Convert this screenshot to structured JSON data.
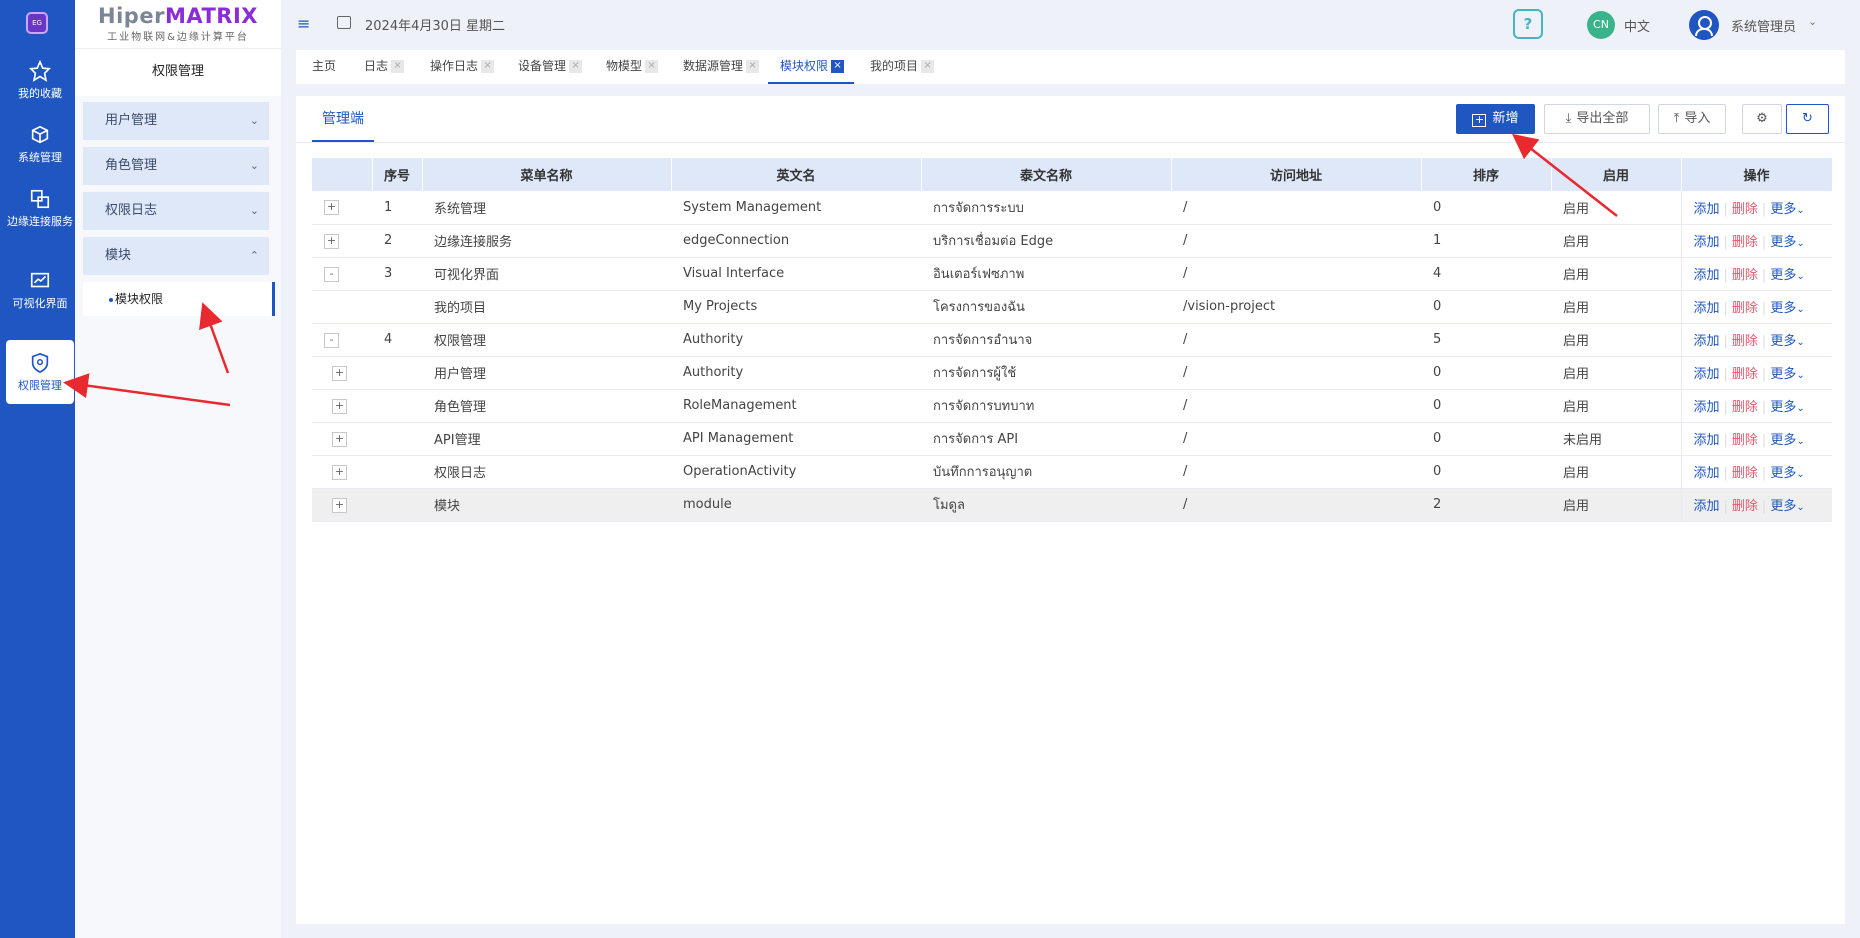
{
  "rail": {
    "logo": "EG",
    "items": [
      {
        "label": "我的收藏",
        "icon": "star-icon"
      },
      {
        "label": "系统管理",
        "icon": "cube-icon"
      },
      {
        "label": "边缘连接服务",
        "icon": "connect-icon"
      },
      {
        "label": "可视化界面",
        "icon": "chart-icon"
      },
      {
        "label": "权限管理",
        "icon": "shield-icon"
      }
    ]
  },
  "brand": {
    "name_a": "Hiper",
    "name_b": "MATRIX",
    "tagline": "工业物联网&边缘计算平台"
  },
  "sidebar": {
    "title": "权限管理",
    "menus": [
      "用户管理",
      "角色管理",
      "权限日志",
      "模块"
    ],
    "submenu": "模块权限"
  },
  "header": {
    "date": "2024年4月30日 星期二",
    "lang_badge": "CN",
    "lang": "中文",
    "user": "系统管理员",
    "help": "?"
  },
  "tabs": [
    {
      "label": "主页"
    },
    {
      "label": "日志"
    },
    {
      "label": "操作日志"
    },
    {
      "label": "设备管理"
    },
    {
      "label": "物模型"
    },
    {
      "label": "数据源管理"
    },
    {
      "label": "模块权限"
    },
    {
      "label": "我的项目"
    }
  ],
  "main": {
    "subtab": "管理端",
    "buttons": {
      "add": "新增",
      "export": "导出全部",
      "import": "导入"
    },
    "columns": [
      "序号",
      "菜单名称",
      "英文名",
      "泰文名称",
      "访问地址",
      "排序",
      "启用",
      "操作"
    ],
    "rows": [
      {
        "expander": "+",
        "no": "1",
        "name": "系统管理",
        "en": "System Management",
        "th": "การจัดการระบบ",
        "url": "/",
        "sort": "0",
        "enabled": "启用"
      },
      {
        "expander": "+",
        "no": "2",
        "name": "边缘连接服务",
        "en": "edgeConnection",
        "th": "บริการเชื่อมต่อ Edge",
        "url": "/",
        "sort": "1",
        "enabled": "启用"
      },
      {
        "expander": "-",
        "no": "3",
        "name": "可视化界面",
        "en": "Visual Interface",
        "th": "อินเตอร์เฟซภาพ",
        "url": "/",
        "sort": "4",
        "enabled": "启用"
      },
      {
        "expander": "",
        "no": "",
        "name": "我的项目",
        "en": "My Projects",
        "th": "โครงการของฉัน",
        "url": "/vision-project",
        "sort": "0",
        "enabled": "启用"
      },
      {
        "expander": "-",
        "no": "4",
        "name": "权限管理",
        "en": "Authority",
        "th": "การจัดการอำนาจ",
        "url": "/",
        "sort": "5",
        "enabled": "启用"
      },
      {
        "expander": "+",
        "no": "",
        "name": "用户管理",
        "en": "Authority",
        "th": "การจัดการผู้ใช้",
        "url": "/",
        "sort": "0",
        "enabled": "启用"
      },
      {
        "expander": "+",
        "no": "",
        "name": "角色管理",
        "en": "RoleManagement",
        "th": "การจัดการบทบาท",
        "url": "/",
        "sort": "0",
        "enabled": "启用"
      },
      {
        "expander": "+",
        "no": "",
        "name": "API管理",
        "en": "API Management",
        "th": "การจัดการ API",
        "url": "/",
        "sort": "0",
        "enabled": "未启用"
      },
      {
        "expander": "+",
        "no": "",
        "name": "权限日志",
        "en": "OperationActivity",
        "th": "บันทึกการอนุญาต",
        "url": "/",
        "sort": "0",
        "enabled": "启用"
      },
      {
        "expander": "+",
        "no": "",
        "name": "模块",
        "en": "module",
        "th": "โมดูล",
        "url": "/",
        "sort": "2",
        "enabled": "启用"
      }
    ],
    "ops": {
      "add": "添加",
      "del": "删除",
      "more": "更多"
    }
  },
  "colors": {
    "primary": "#1f56c1",
    "danger": "#e4576b",
    "annotation": "#e8292f"
  }
}
